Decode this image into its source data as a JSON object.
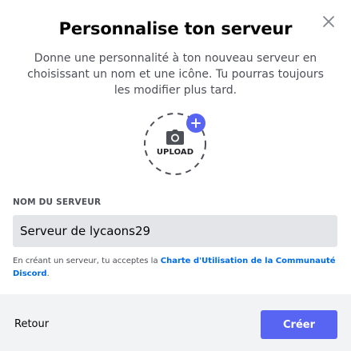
{
  "modal": {
    "title": "Personnalise ton serveur",
    "subtitle": "Donne une personnalité à ton nouveau serveur en choisissant un nom et une icône. Tu pourras toujours les modifier plus tard."
  },
  "upload": {
    "label": "UPLOAD",
    "icon": "camera-icon",
    "badge_icon": "plus-icon"
  },
  "server_name": {
    "label": "NOM DU SERVEUR",
    "value": "Serveur de lycaons29"
  },
  "terms": {
    "prefix": "En créant un serveur, tu acceptes la ",
    "link": "Charte d'Utilisation de la Communauté Discord",
    "suffix": "."
  },
  "footer": {
    "back_label": "Retour",
    "create_label": "Créer"
  },
  "colors": {
    "accent": "#5865f2",
    "link": "#006ce7",
    "footer_bg": "#f2f3f5",
    "input_bg": "#e3e5e8"
  }
}
